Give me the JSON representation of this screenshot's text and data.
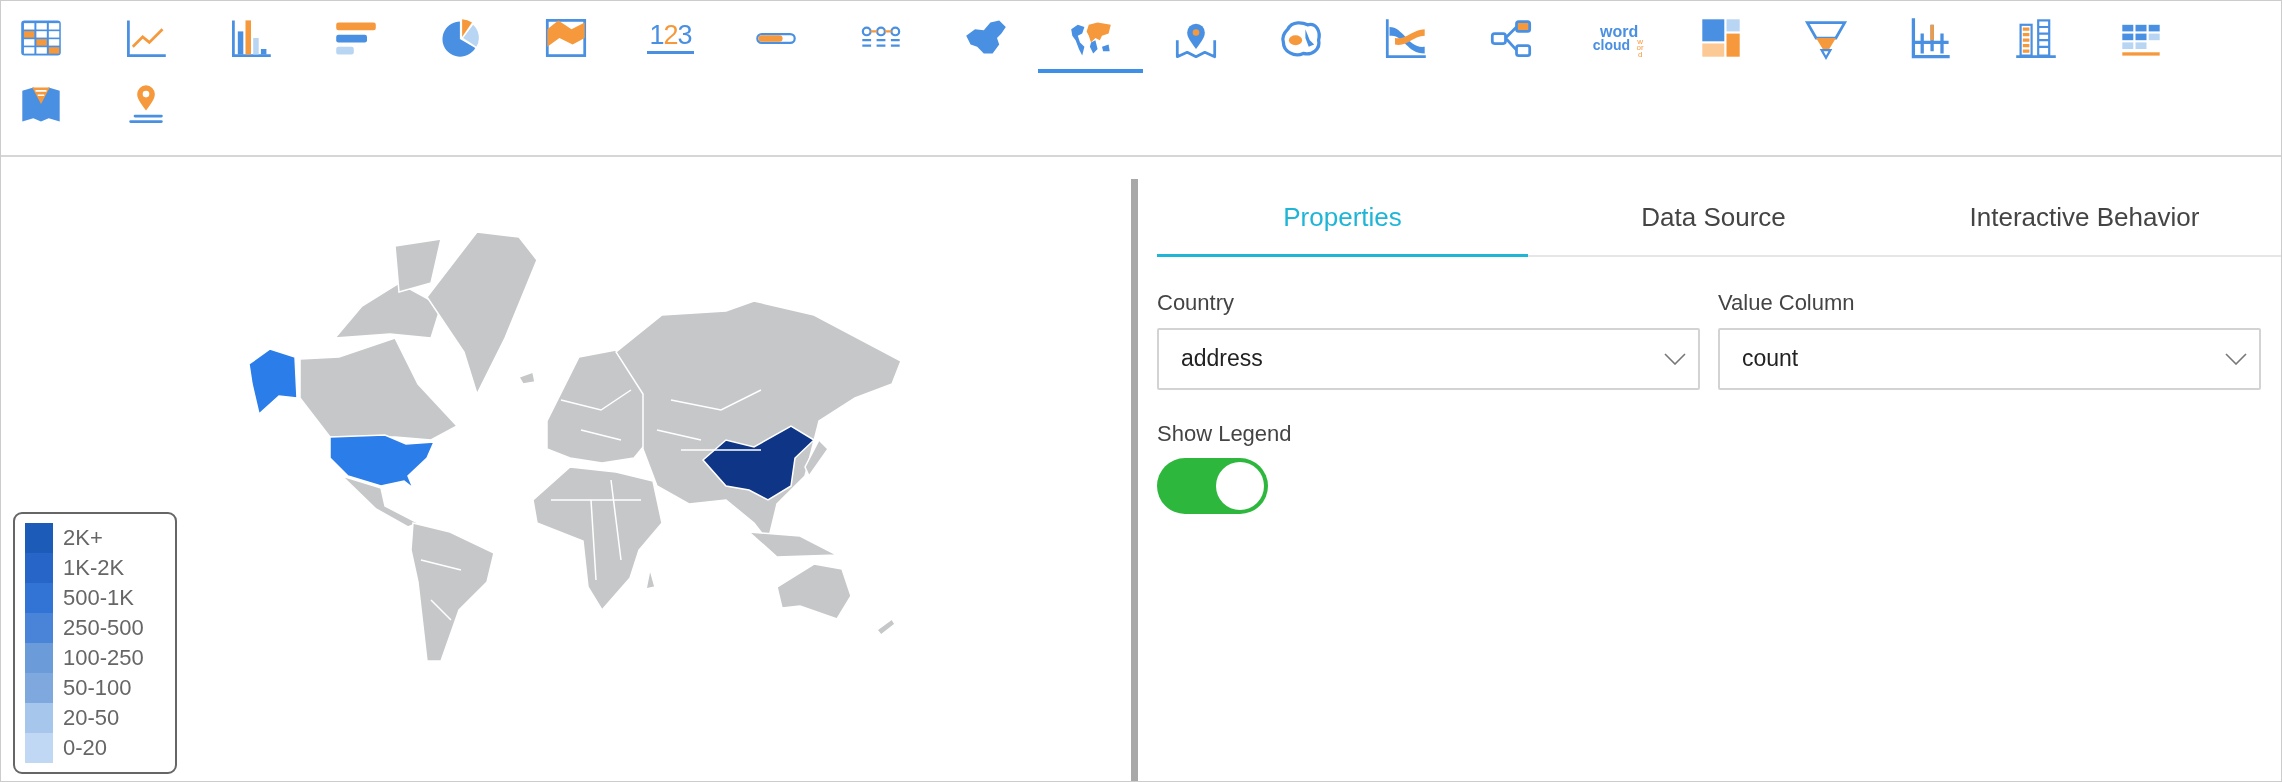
{
  "toolbar": {
    "items": [
      {
        "kind": "table",
        "selected": false
      },
      {
        "kind": "line",
        "selected": false
      },
      {
        "kind": "bar",
        "selected": false
      },
      {
        "kind": "hbar",
        "selected": false
      },
      {
        "kind": "pie",
        "selected": false
      },
      {
        "kind": "area",
        "selected": false
      },
      {
        "kind": "number",
        "selected": false,
        "text": "123"
      },
      {
        "kind": "progress",
        "selected": false
      },
      {
        "kind": "steps",
        "selected": false
      },
      {
        "kind": "chinamap",
        "selected": false
      },
      {
        "kind": "worldmap",
        "selected": true
      },
      {
        "kind": "pinmap",
        "selected": false
      },
      {
        "kind": "heat",
        "selected": false
      },
      {
        "kind": "sankey",
        "selected": false
      },
      {
        "kind": "tree",
        "selected": false
      },
      {
        "kind": "wordcloud",
        "selected": false,
        "words": [
          "word",
          "cloud",
          "word"
        ]
      },
      {
        "kind": "treemap",
        "selected": false
      },
      {
        "kind": "funnel",
        "selected": false
      },
      {
        "kind": "timeline",
        "selected": false
      },
      {
        "kind": "columns",
        "selected": false
      },
      {
        "kind": "grid",
        "selected": false
      },
      {
        "kind": "foldmap",
        "selected": false
      },
      {
        "kind": "location",
        "selected": false
      }
    ]
  },
  "map": {
    "legend": [
      {
        "label": "2K+",
        "color": "#1c5cb8"
      },
      {
        "label": "1K-2K",
        "color": "#2766c8"
      },
      {
        "label": "500-1K",
        "color": "#3274d6"
      },
      {
        "label": "250-500",
        "color": "#4a84d8"
      },
      {
        "label": "100-250",
        "color": "#6b9bd8"
      },
      {
        "label": "50-100",
        "color": "#7fa9de"
      },
      {
        "label": "20-50",
        "color": "#a6c6ec"
      },
      {
        "label": "0-20",
        "color": "#c0d8f3"
      }
    ]
  },
  "tabs": [
    {
      "label": "Properties",
      "selected": true
    },
    {
      "label": "Data Source",
      "selected": false
    },
    {
      "label": "Interactive Behavior",
      "selected": false
    }
  ],
  "fields": [
    {
      "label": "Country",
      "value": "address"
    },
    {
      "label": "Value Column",
      "value": "count"
    }
  ],
  "toggle": {
    "label": "Show Legend",
    "on": true
  }
}
